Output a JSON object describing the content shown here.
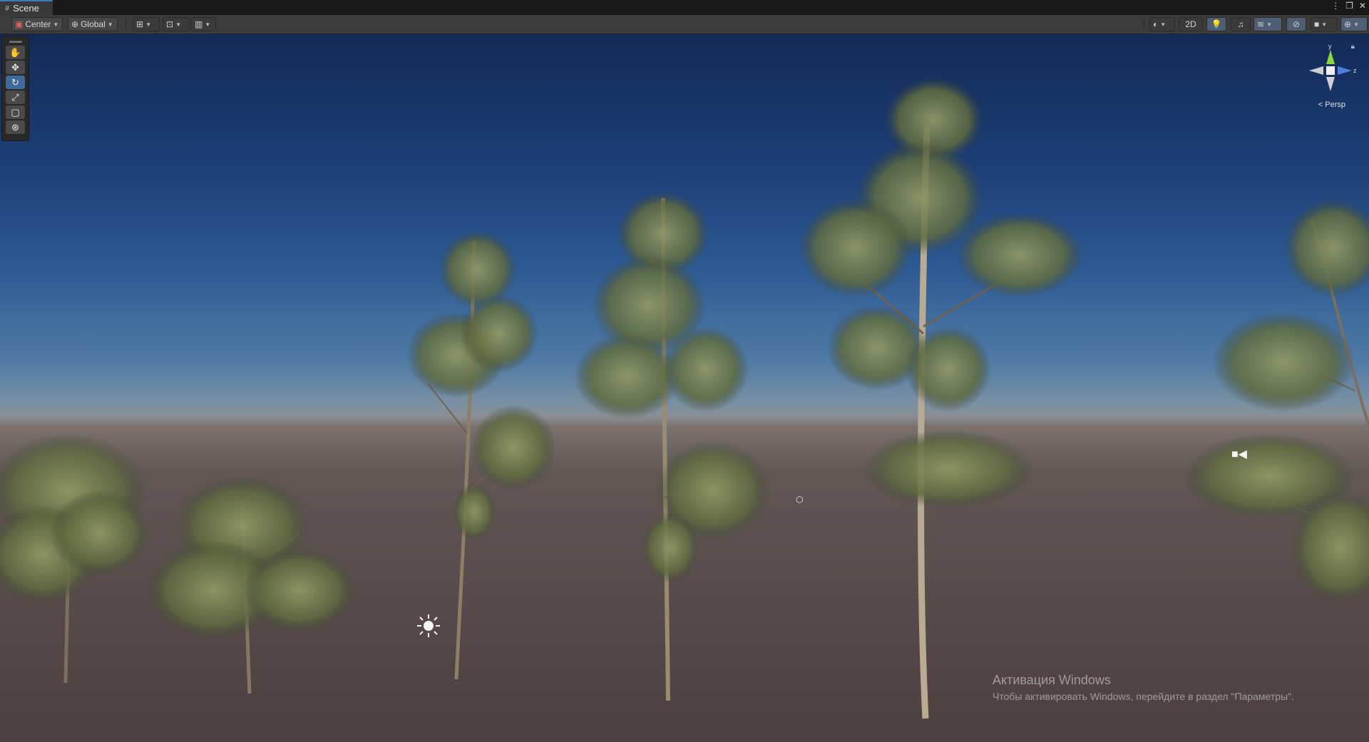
{
  "window": {
    "tab_label": "Scene",
    "tab_icon": "grid-icon",
    "controls": [
      "more-icon",
      "maximize-icon",
      "close-icon"
    ]
  },
  "toolbar": {
    "pivot_mode": "Center",
    "pivot_rotation": "Global",
    "toggle_2d": "2D"
  },
  "tools": [
    "hand-tool",
    "move-tool",
    "rotate-tool",
    "scale-tool",
    "rect-tool",
    "transform-tool"
  ],
  "gizmo": {
    "axis_y": "y",
    "axis_z": "z",
    "projection": "Persp"
  },
  "colors": {
    "sky_top": "#132a57",
    "sky_horizon": "#7890a4",
    "ground": "#564b4a",
    "axis_y": "#8bd83a",
    "axis_z": "#4f7fe0",
    "foliage": "#707a4c",
    "trunk": "#a89a80"
  },
  "watermark": {
    "title": "Активация Windows",
    "subtitle": "Чтобы активировать Windows, перейдите в раздел \"Параметры\"."
  }
}
